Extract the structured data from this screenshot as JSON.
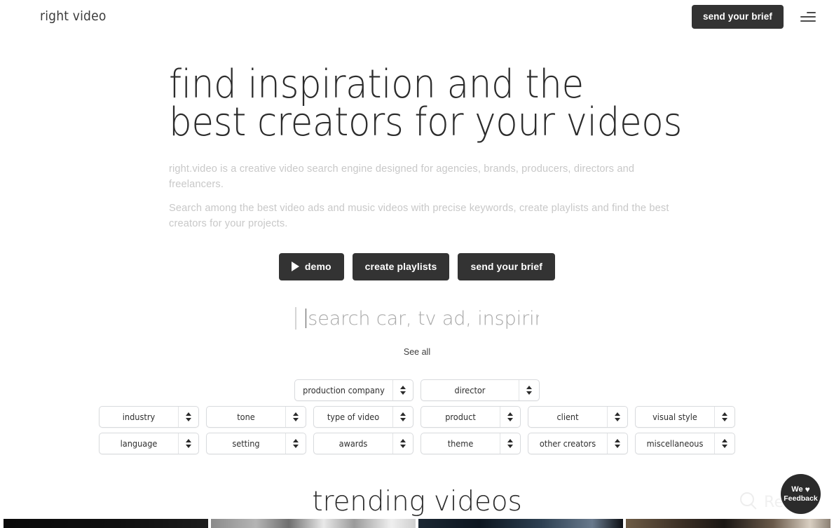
{
  "header": {
    "brand": "right video",
    "brief_button": "send your brief",
    "menu_icon": "hamburger-menu-icon"
  },
  "hero": {
    "headline_line1": "find inspiration and the",
    "headline_line2": "best creators for your videos",
    "lede_1": "right.video is a creative video search engine designed for agencies, brands, producers, directors and freelancers.",
    "lede_2": "Search among the best video ads and music videos with precise keywords, create playlists and find the best creators for your projects.",
    "buttons": [
      {
        "label": "demo",
        "icon": "play-icon"
      },
      {
        "label": "create playlists",
        "icon": ""
      },
      {
        "label": "send your brief",
        "icon": ""
      }
    ]
  },
  "search": {
    "placeholder": "search car, tv ad, inspiring",
    "value": "",
    "see_all": "See all"
  },
  "filters": {
    "row1": [
      {
        "label": "production company",
        "width": "w-md"
      },
      {
        "label": "director",
        "width": "w-md"
      }
    ],
    "row2": [
      {
        "label": "industry",
        "width": "w-sm"
      },
      {
        "label": "tone",
        "width": "w-sm"
      },
      {
        "label": "type of video",
        "width": "w-sm"
      },
      {
        "label": "product",
        "width": "w-sm"
      },
      {
        "label": "client",
        "width": "w-sm"
      },
      {
        "label": "visual style",
        "width": "w-sm"
      }
    ],
    "row3": [
      {
        "label": "language",
        "width": "w-sm"
      },
      {
        "label": "setting",
        "width": "w-sm"
      },
      {
        "label": "awards",
        "width": "w-sm"
      },
      {
        "label": "theme",
        "width": "w-sm"
      },
      {
        "label": "other creators",
        "width": "w-sm"
      },
      {
        "label": "miscellaneous",
        "width": "w-sm"
      }
    ]
  },
  "trending": {
    "title": "trending videos",
    "thumbnails": [
      {
        "name": "video-thumbnail-1"
      },
      {
        "name": "video-thumbnail-2"
      },
      {
        "name": "video-thumbnail-3"
      },
      {
        "name": "video-thumbnail-4"
      }
    ]
  },
  "watermark": {
    "text": "Revain",
    "logo_icon": "revain-magnifier-icon"
  },
  "feedback": {
    "line1": "We",
    "heart": "♥",
    "line2": "Feedback"
  },
  "colors": {
    "button_dark": "#333333",
    "text_dark": "#2c2c2c",
    "text_muted": "#c8c8c8",
    "border": "#d8dadd",
    "page_bg": "#ffffff"
  }
}
